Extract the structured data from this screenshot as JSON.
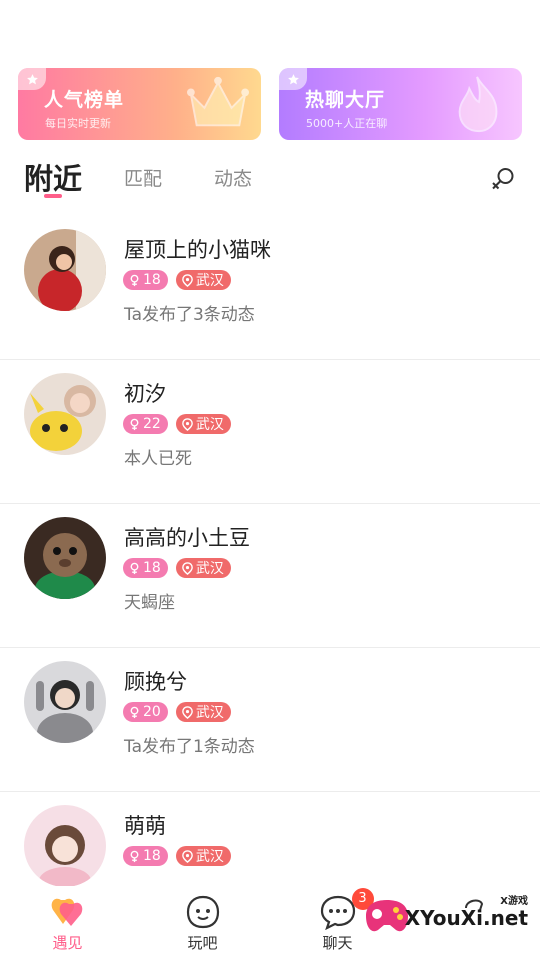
{
  "banners": [
    {
      "title": "人气榜单",
      "subtitle": "每日实时更新",
      "deco_icon": "crown-icon"
    },
    {
      "title": "热聊大厅",
      "subtitle": "5000+人正在聊",
      "deco_icon": "flame-icon"
    }
  ],
  "tabs": {
    "items": [
      "附近",
      "匹配",
      "动态"
    ],
    "active": "附近",
    "filter_icon": "gender-filter-icon"
  },
  "users": [
    {
      "name": "屋顶上的小猫咪",
      "age": "18",
      "location": "武汉",
      "desc": "Ta发布了3条动态"
    },
    {
      "name": "初汐",
      "age": "22",
      "location": "武汉",
      "desc": "本人已死"
    },
    {
      "name": "高高的小土豆",
      "age": "18",
      "location": "武汉",
      "desc": "天蝎座"
    },
    {
      "name": "顾挽兮",
      "age": "20",
      "location": "武汉",
      "desc": "Ta发布了1条动态"
    },
    {
      "name": "萌萌",
      "age": "18",
      "location": "武汉",
      "desc": ""
    }
  ],
  "nav": {
    "items": [
      {
        "label": "遇见",
        "icon": "hearts-icon",
        "active": true
      },
      {
        "label": "玩吧",
        "icon": "face-icon",
        "active": false
      },
      {
        "label": "聊天",
        "icon": "chat-bubble-icon",
        "active": false,
        "badge": "3"
      },
      {
        "label": "",
        "icon": "profile-icon",
        "active": false
      }
    ]
  },
  "watermark": {
    "small": "X游戏",
    "main": "XYouXi.net"
  },
  "colors": {
    "accent": "#ff5e8a",
    "gender_tag": "#f47bb0",
    "location_tag": "#f06a6a",
    "badge": "#ff4a3a"
  }
}
